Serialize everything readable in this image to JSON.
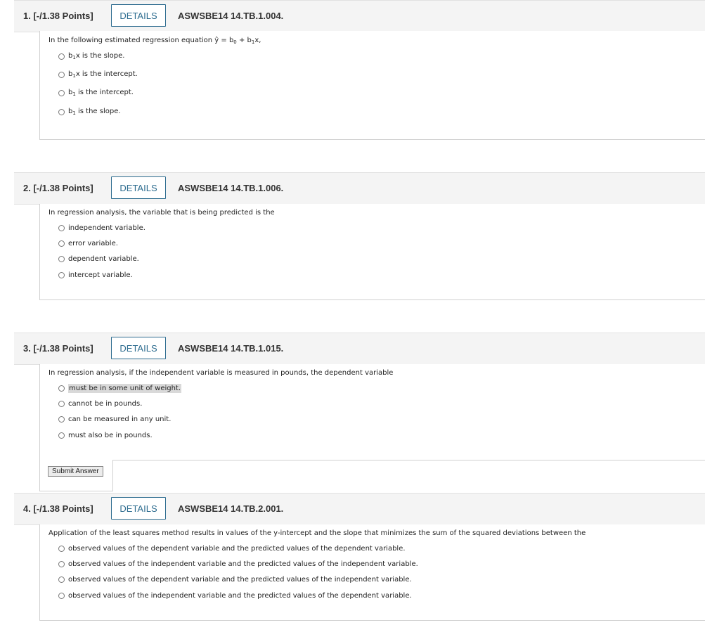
{
  "questions": [
    {
      "number": "1.",
      "points": "[-/1.38 Points]",
      "details": "DETAILS",
      "id": "ASWSBE14 14.TB.1.004.",
      "prompt": "In the following estimated regression equation ŷ = b",
      "prompt_sub0": "0",
      "prompt_plus": " + b",
      "prompt_sub1": "1",
      "prompt_end": "x,",
      "options": [
        {
          "pre": "b",
          "sub": "1",
          "post": "x is the slope."
        },
        {
          "pre": "b",
          "sub": "1",
          "post": "x is the intercept."
        },
        {
          "pre": "b",
          "sub": "1",
          "post": " is the intercept."
        },
        {
          "pre": "b",
          "sub": "1",
          "post": " is the slope."
        }
      ]
    },
    {
      "number": "2.",
      "points": "[-/1.38 Points]",
      "details": "DETAILS",
      "id": "ASWSBE14 14.TB.1.006.",
      "prompt": "In regression analysis, the variable that is being predicted is the",
      "options": [
        "independent variable.",
        "error variable.",
        "dependent variable.",
        "intercept variable."
      ]
    },
    {
      "number": "3.",
      "points": "[-/1.38 Points]",
      "details": "DETAILS",
      "id": "ASWSBE14 14.TB.1.015.",
      "prompt": "In regression analysis, if the independent variable is measured in pounds, the dependent variable",
      "options": [
        "must be in some unit of weight.",
        "cannot be in pounds.",
        "can be measured in any unit.",
        "must also be in pounds."
      ]
    },
    {
      "number": "4.",
      "points": "[-/1.38 Points]",
      "details": "DETAILS",
      "id": "ASWSBE14 14.TB.2.001.",
      "prompt": "Application of the least squares method results in values of the y-intercept and the slope that minimizes the sum of the squared deviations between the",
      "options": [
        "observed values of the dependent variable and the predicted values of the dependent variable.",
        "observed values of the independent variable and the predicted values of the independent variable.",
        "observed values of the dependent variable and the predicted values of the independent variable.",
        "observed values of the independent variable and the predicted values of the dependent variable."
      ]
    }
  ],
  "submit_label": "Submit Answer"
}
